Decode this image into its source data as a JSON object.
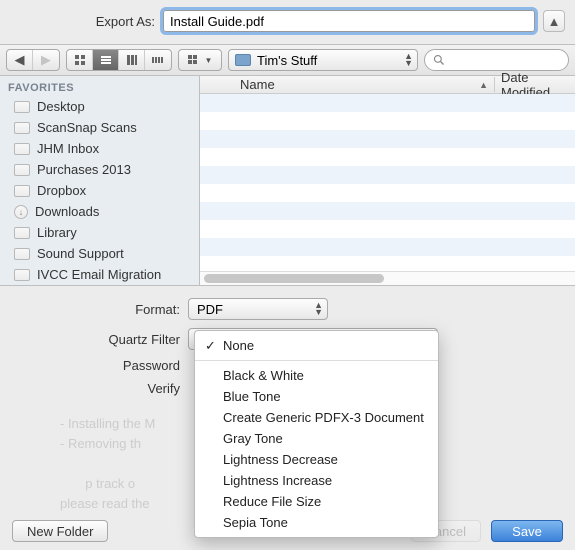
{
  "export": {
    "label": "Export As:",
    "filename": "Install Guide.pdf"
  },
  "path_popup": "Tim's Stuff",
  "search": {
    "placeholder": ""
  },
  "sidebar": {
    "header": "FAVORITES",
    "items": [
      {
        "label": "Desktop",
        "icon": "folder"
      },
      {
        "label": "ScanSnap Scans",
        "icon": "folder"
      },
      {
        "label": "JHM Inbox",
        "icon": "folder"
      },
      {
        "label": "Purchases 2013",
        "icon": "folder"
      },
      {
        "label": "Dropbox",
        "icon": "folder"
      },
      {
        "label": "Downloads",
        "icon": "download"
      },
      {
        "label": "Library",
        "icon": "folder"
      },
      {
        "label": "Sound Support",
        "icon": "folder"
      },
      {
        "label": "IVCC Email Migration",
        "icon": "folder"
      }
    ]
  },
  "columns": {
    "name": "Name",
    "date": "Date Modified"
  },
  "format": {
    "label": "Format:",
    "value": "PDF"
  },
  "quartz": {
    "label": "Quartz Filter",
    "selected": "None",
    "options": [
      "None",
      "Black & White",
      "Blue Tone",
      "Create Generic PDFX-3 Document",
      "Gray Tone",
      "Lightness Decrease",
      "Lightness Increase",
      "Reduce File Size",
      "Sepia Tone"
    ]
  },
  "ghost": {
    "password": "Password",
    "verify": "Verify"
  },
  "buttons": {
    "new_folder": "New Folder",
    "cancel": "Cancel",
    "save": "Save"
  }
}
